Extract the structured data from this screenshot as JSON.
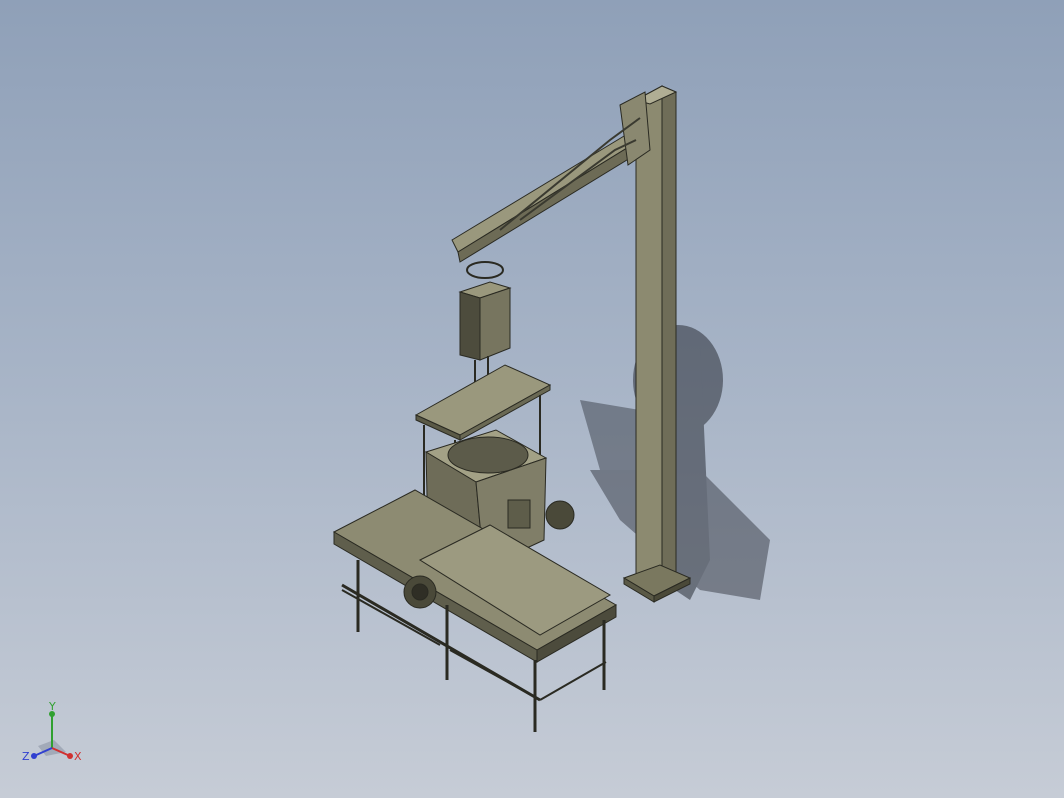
{
  "viewport": {
    "background_top": "#8fa0b8",
    "background_bottom": "#c6ccd6",
    "model_color": "#8a8a72",
    "edge_color": "#2a2a22"
  },
  "triad": {
    "x_label": "X",
    "y_label": "Y",
    "z_label": "Z",
    "x_color": "#d03030",
    "y_color": "#30a030",
    "z_color": "#3040d0"
  }
}
